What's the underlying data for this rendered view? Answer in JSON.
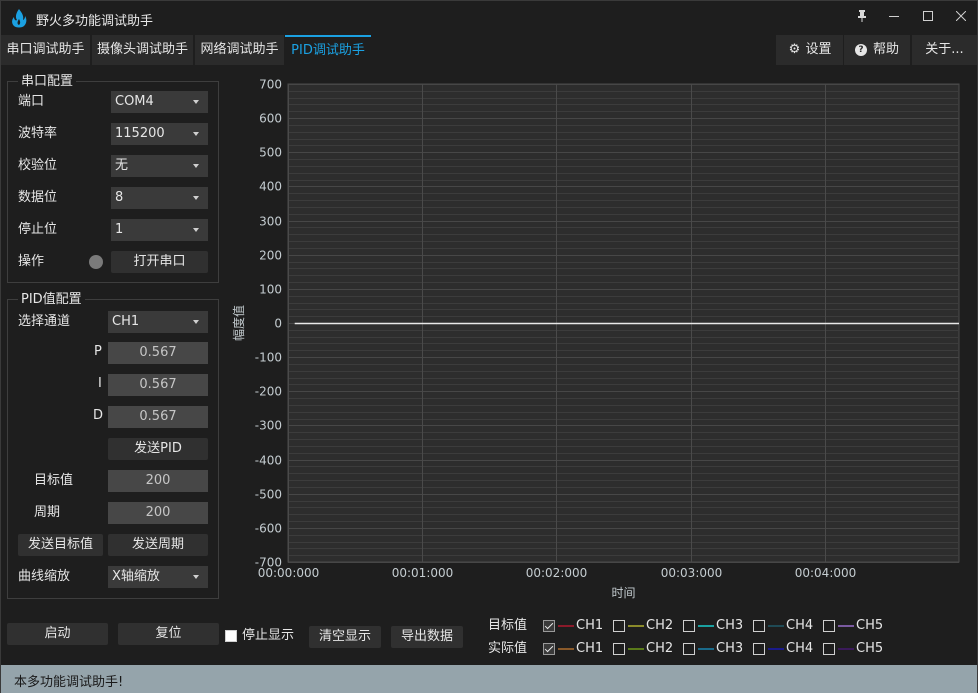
{
  "window": {
    "title": "野火多功能调试助手",
    "controls": {
      "pin": "pin-icon",
      "minimize": "minimize-icon",
      "maximize": "maximize-icon",
      "close": "close-icon"
    }
  },
  "tabs": [
    {
      "label": "串口调试助手",
      "active": false
    },
    {
      "label": "摄像头调试助手",
      "active": false
    },
    {
      "label": "网络调试助手",
      "active": false
    },
    {
      "label": "PID调试助手",
      "active": true
    }
  ],
  "header_buttons": {
    "settings": "设置",
    "help": "帮助",
    "about": "关于..."
  },
  "serial_config": {
    "title": "串口配置",
    "port_label": "端口",
    "port_value": "COM4",
    "baud_label": "波特率",
    "baud_value": "115200",
    "parity_label": "校验位",
    "parity_value": "无",
    "databits_label": "数据位",
    "databits_value": "8",
    "stopbits_label": "停止位",
    "stopbits_value": "1",
    "operation_label": "操作",
    "open_button": "打开串口",
    "status_color": "#7a7a7a"
  },
  "pid_config": {
    "title": "PID值配置",
    "channel_label": "选择通道",
    "channel_value": "CH1",
    "p_label": "P",
    "p_value": "0.567",
    "i_label": "I",
    "i_value": "0.567",
    "d_label": "D",
    "d_value": "0.567",
    "send_pid_button": "发送PID",
    "target_label": "目标值",
    "target_value": "200",
    "period_label": "周期",
    "period_value": "200",
    "send_target_button": "发送目标值",
    "send_period_button": "发送周期",
    "zoom_label": "曲线缩放",
    "zoom_value": "X轴缩放"
  },
  "chart_data": {
    "type": "line",
    "title": "",
    "xlabel": "时间",
    "ylabel": "幅度值",
    "ylim": [
      -700,
      700
    ],
    "xlim_seconds": [
      0,
      5
    ],
    "y_ticks": [
      700,
      600,
      500,
      400,
      300,
      200,
      100,
      0,
      -100,
      -200,
      -300,
      -400,
      -500,
      -600,
      -700
    ],
    "y_minor_step": 20,
    "x_ticks": [
      {
        "t": 0,
        "label": "00:00:000"
      },
      {
        "t": 1,
        "label": "00:01:000"
      },
      {
        "t": 2,
        "label": "00:02:000"
      },
      {
        "t": 3,
        "label": "00:03:000"
      },
      {
        "t": 4,
        "label": "00:04:000"
      }
    ],
    "grid": true,
    "series": [
      {
        "name": "baseline",
        "x": [
          0.05,
          5.0
        ],
        "y": [
          0,
          0
        ],
        "color": "#e8e8e8"
      }
    ]
  },
  "controls": {
    "start_button": "启动",
    "reset_button": "复位",
    "stop_display_label": "停止显示",
    "stop_display_checked": false,
    "clear_button": "清空显示",
    "export_button": "导出数据"
  },
  "legend": {
    "target_label": "目标值",
    "actual_label": "实际值",
    "target": [
      {
        "name": "CH1",
        "checked": true,
        "color": "#8b1a2a"
      },
      {
        "name": "CH2",
        "checked": false,
        "color": "#8a8a2a"
      },
      {
        "name": "CH3",
        "checked": false,
        "color": "#1aa0a0"
      },
      {
        "name": "CH4",
        "checked": false,
        "color": "#1f4a55"
      },
      {
        "name": "CH5",
        "checked": false,
        "color": "#7a5aa0"
      }
    ],
    "actual": [
      {
        "name": "CH1",
        "checked": true,
        "color": "#8a5a2a"
      },
      {
        "name": "CH2",
        "checked": false,
        "color": "#5a7a1a"
      },
      {
        "name": "CH3",
        "checked": false,
        "color": "#1a6a8a"
      },
      {
        "name": "CH4",
        "checked": false,
        "color": "#1a1a8a"
      },
      {
        "name": "CH5",
        "checked": false,
        "color": "#3a1a5a"
      }
    ]
  },
  "status_bar": {
    "text": "本多功能调试助手!"
  },
  "colors": {
    "accent": "#1ba1e2",
    "background": "#1e1e1e",
    "plot_background": "#2d2d2d",
    "status_bar": "#95a4ab"
  }
}
